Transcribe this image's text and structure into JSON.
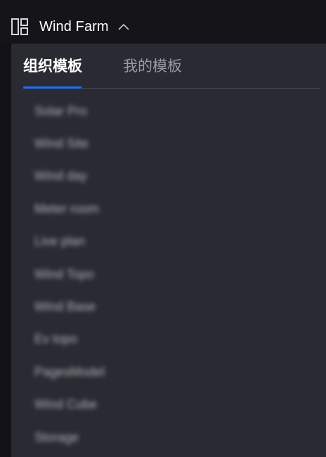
{
  "header": {
    "title": "Wind Farm",
    "layout_icon": "layout-grid-icon",
    "caret_icon": "chevron-up-icon"
  },
  "tabs": [
    {
      "label": "组织模板",
      "active": true
    },
    {
      "label": "我的模板",
      "active": false
    }
  ],
  "template_list": [
    {
      "label": "Solar Pro"
    },
    {
      "label": "Wind Site"
    },
    {
      "label": "Wind day"
    },
    {
      "label": "Meter room"
    },
    {
      "label": "Live plan"
    },
    {
      "label": "Wind Topo"
    },
    {
      "label": "Wind Base"
    },
    {
      "label": "Ev topo"
    },
    {
      "label": "PagesModel"
    },
    {
      "label": "Wind Cube"
    },
    {
      "label": "Storage"
    }
  ],
  "colors": {
    "accent": "#1f6fff",
    "panel_bg": "#2a2a32",
    "header_bg": "#141419",
    "active_text": "#ffffff",
    "inactive_text": "#9a9aa4"
  }
}
